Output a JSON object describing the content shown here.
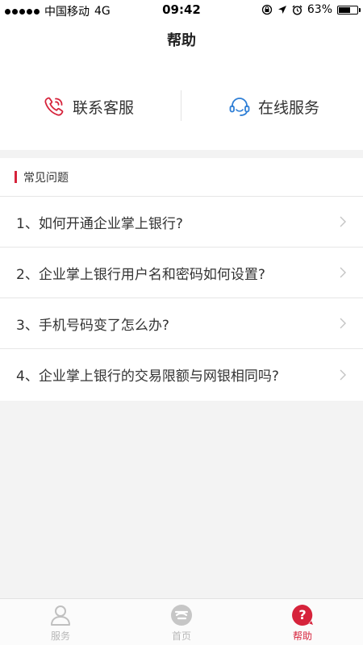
{
  "status_bar": {
    "carrier": "中国移动",
    "network": "4G",
    "time": "09:42",
    "battery_percent_text": "63%",
    "battery_level": 0.63
  },
  "header": {
    "title": "帮助"
  },
  "quick_actions": [
    {
      "label": "联系客服",
      "icon": "phone-icon",
      "color": "#d6233b"
    },
    {
      "label": "在线服务",
      "icon": "headset-icon",
      "color": "#2f7fd6"
    }
  ],
  "faq": {
    "title": "常见问题",
    "items": [
      "1、如何开通企业掌上银行?",
      "2、企业掌上银行用户名和密码如何设置?",
      "3、手机号码变了怎么办?",
      "4、企业掌上银行的交易限额与网银相同吗?"
    ]
  },
  "tabbar": {
    "items": [
      {
        "label": "服务",
        "icon": "user-icon",
        "active": false
      },
      {
        "label": "首页",
        "icon": "home-logo-icon",
        "active": false
      },
      {
        "label": "帮助",
        "icon": "help-icon",
        "active": true
      }
    ]
  },
  "colors": {
    "accent": "#d6233b",
    "online_blue": "#2f7fd6",
    "inactive": "#b8b8b8"
  }
}
